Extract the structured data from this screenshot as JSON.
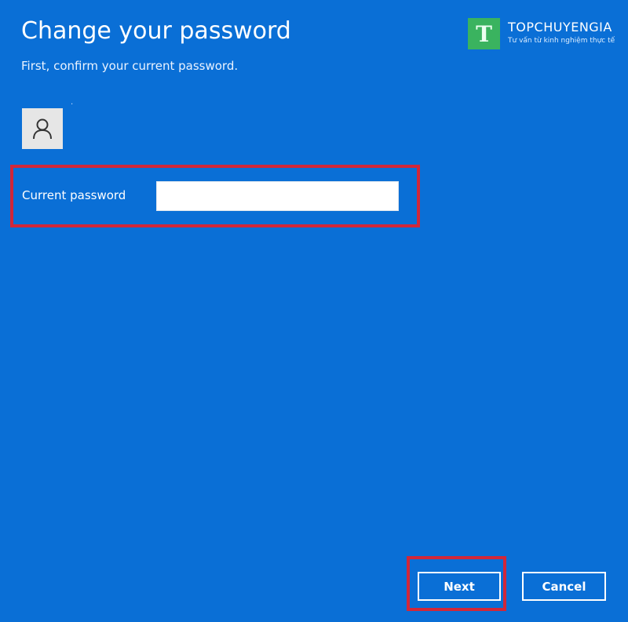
{
  "dialog": {
    "title": "Change your password",
    "subtitle": "First, confirm your current password.",
    "avatar_icon": "user-icon",
    "field_label": "Current password",
    "field_value": "",
    "next_label": "Next",
    "cancel_label": "Cancel"
  },
  "watermark": {
    "mark": "T",
    "name": "TOPCHUYENGIA",
    "tagline": "Tư vấn từ kinh nghiệm thực tế"
  },
  "colors": {
    "background": "#0a6fd6",
    "highlight": "#d1273a",
    "logo_green": "#3ab35f"
  }
}
